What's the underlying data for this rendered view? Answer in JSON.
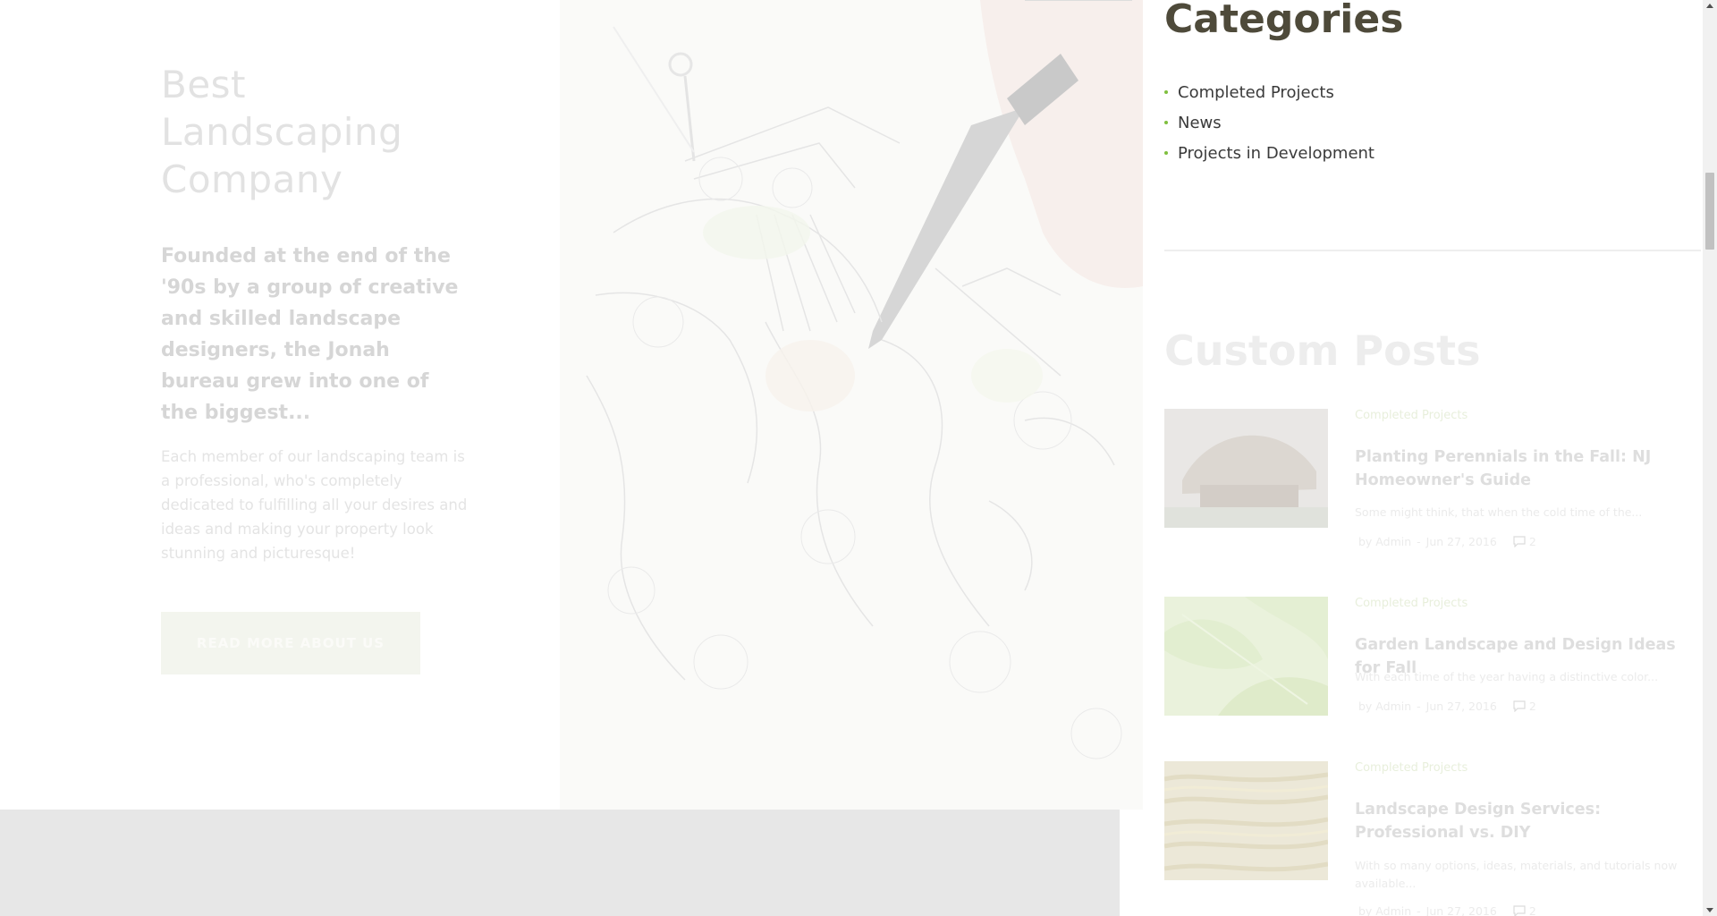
{
  "about": {
    "heading": "Best Landscaping Company",
    "lead": "Founded at the end of the '90s by a group of creative and skilled landscape designers, the Jonah bureau grew into one of the biggest...",
    "body": "Each member of our landscaping team is a professional, who's completely dedicated to fulfilling all your desires and ideas and making your property look stunning and picturesque!",
    "button_label": "READ MORE ABOUT US"
  },
  "sidebar": {
    "categories_title": "Categories",
    "categories": [
      {
        "label": "Completed Projects"
      },
      {
        "label": "News"
      },
      {
        "label": "Projects in Development"
      }
    ],
    "custom_posts_title": "Custom Posts",
    "posts": [
      {
        "category": "Completed Projects",
        "title": "Planting Perennials in the Fall: NJ Homeowner's Guide",
        "excerpt": "Some might think, that when the cold time of the...",
        "author": "by Admin",
        "date": "Jun 27, 2016",
        "comments": "2"
      },
      {
        "category": "Completed Projects",
        "title": "Garden Landscape and Design Ideas for Fall",
        "excerpt": "With each time of the year having a distinctive color...",
        "author": "by Admin",
        "date": "Jun 27, 2016",
        "comments": "2"
      },
      {
        "category": "Completed Projects",
        "title": "Landscape Design Services: Professional vs. DIY",
        "excerpt": "With so many options, ideas, materials, and tutorials now available...",
        "author": "by Admin",
        "date": "Jun 27, 2016",
        "comments": "2"
      }
    ]
  },
  "colors": {
    "accent_green": "#7fbf3e",
    "heading_dark": "#4e4a3a",
    "band_grey": "#e7e7e7"
  }
}
